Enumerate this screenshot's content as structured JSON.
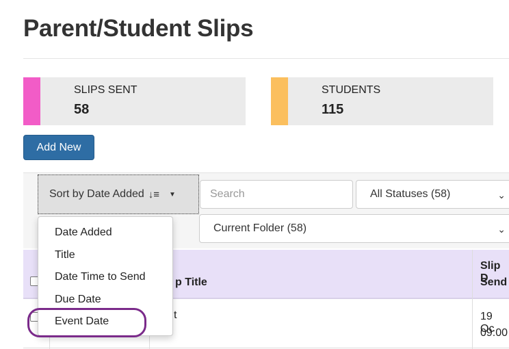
{
  "page": {
    "title": "Parent/Student Slips"
  },
  "stats": [
    {
      "label": "SLIPS SENT",
      "value": "58",
      "color": "#f25cc7"
    },
    {
      "label": "STUDENTS",
      "value": "115",
      "color": "#fbbf5e"
    }
  ],
  "actions": {
    "add_new": "Add New"
  },
  "toolbar": {
    "sort_label": "Sort by Date Added",
    "search_placeholder": "Search",
    "status_filter": "All Statuses (58)",
    "folder_filter": "Current Folder (58)"
  },
  "sort_menu": {
    "items": [
      "Date Added",
      "Title",
      "Date Time to Send",
      "Due Date",
      "Event Date"
    ],
    "highlighted": "Event Date"
  },
  "table": {
    "headers": {
      "title_partial": "p Title",
      "send_partial_1": "Slip D",
      "send_partial_2": "Send"
    },
    "rows": [
      {
        "title_partial": "t",
        "date_partial_1": "19 Oc",
        "date_partial_2": "09:00"
      }
    ]
  },
  "colors": {
    "primary": "#2e6da4",
    "header_bg": "#e8e0f8",
    "highlight": "#7a2a8a"
  }
}
